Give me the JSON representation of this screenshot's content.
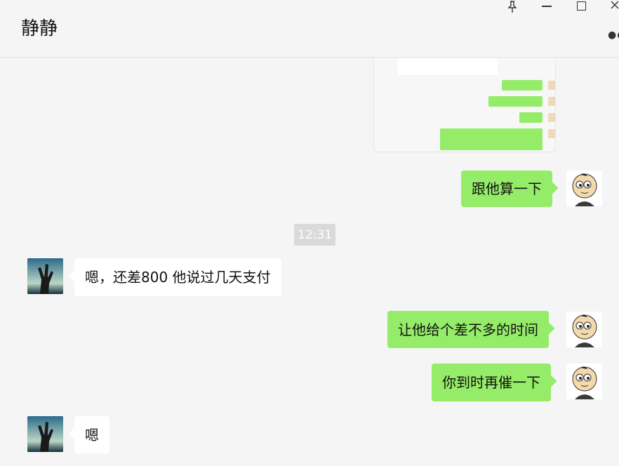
{
  "window": {
    "title": "静静",
    "pin_icon": "pin-icon",
    "minimize_icon": "minimize-icon",
    "maximize_icon": "maximize-icon",
    "close_icon": "close-icon",
    "more_icon": "more-icon"
  },
  "colors": {
    "background": "#f5f5f5",
    "outgoing_bubble": "#95ec69",
    "incoming_bubble": "#ffffff",
    "timestamp_bg": "#dadada"
  },
  "messages": [
    {
      "type": "image",
      "direction": "out"
    },
    {
      "type": "text",
      "direction": "out",
      "text": "跟他算一下"
    },
    {
      "type": "time",
      "text": "12:31"
    },
    {
      "type": "text",
      "direction": "in",
      "text": "嗯，还差800 他说过几天支付"
    },
    {
      "type": "text",
      "direction": "out",
      "text": "让他给个差不多的时间"
    },
    {
      "type": "text",
      "direction": "out",
      "text": "你到时再催一下"
    },
    {
      "type": "text",
      "direction": "in",
      "text": "嗯"
    }
  ]
}
